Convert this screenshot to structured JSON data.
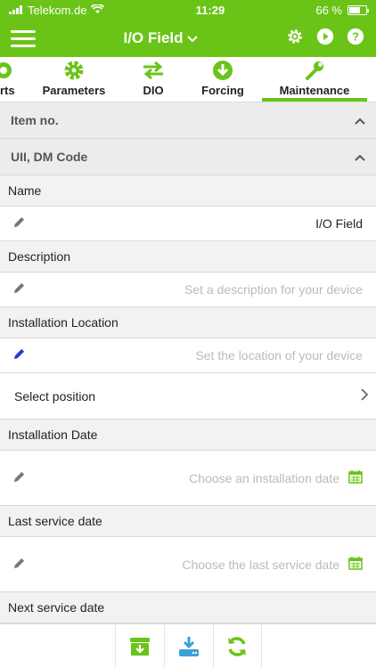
{
  "status": {
    "carrier": "Telekom.de",
    "time": "11:29",
    "battery": "66 %",
    "battery_level": 0.66
  },
  "nav": {
    "title": "I/O Field"
  },
  "tabs": [
    {
      "label": "rts"
    },
    {
      "label": "Parameters"
    },
    {
      "label": "DIO"
    },
    {
      "label": "Forcing"
    },
    {
      "label": "Maintenance",
      "active": true
    }
  ],
  "sections": {
    "item_no": "Item no.",
    "uii": "UII, DM Code"
  },
  "fields": {
    "name": {
      "label": "Name",
      "value": "I/O Field"
    },
    "description": {
      "label": "Description",
      "placeholder": "Set a description for your device"
    },
    "location": {
      "label": "Installation Location",
      "placeholder": "Set the location of your device"
    },
    "position": {
      "label": "Select position"
    },
    "install_date": {
      "label": "Installation Date",
      "placeholder": "Choose an installation date"
    },
    "last_service": {
      "label": "Last service date",
      "placeholder": "Choose the last service date"
    },
    "next_service": {
      "label": "Next service date"
    }
  },
  "colors": {
    "accent": "#6ac417",
    "edit_active": "#1a3fd0"
  }
}
